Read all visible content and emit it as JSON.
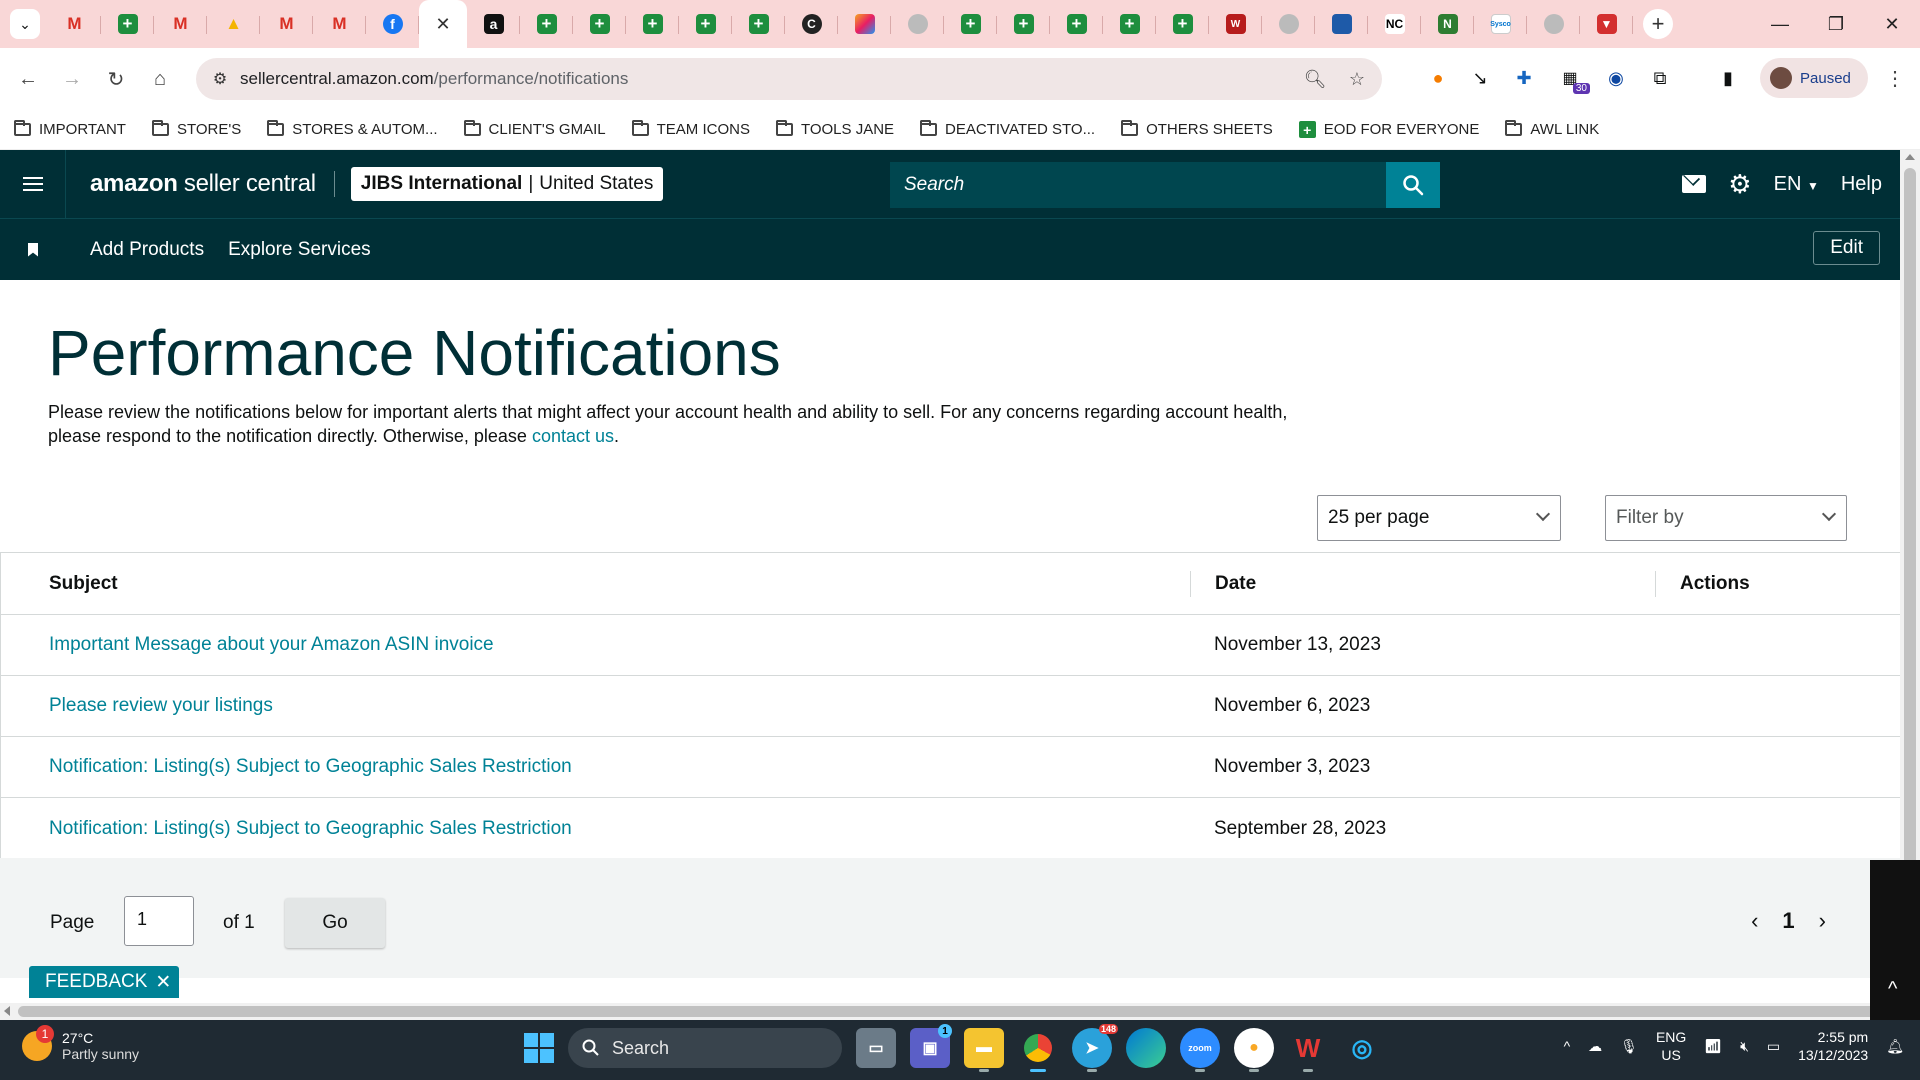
{
  "browser": {
    "tabs": [
      {
        "icon": "gmail-icon",
        "glyph": "M",
        "kind": "gmail"
      },
      {
        "icon": "sheets-icon",
        "glyph": "+",
        "kind": "sheet"
      },
      {
        "icon": "gmail-icon",
        "glyph": "M",
        "kind": "gmail"
      },
      {
        "icon": "drive-icon",
        "glyph": "▲",
        "kind": "drive"
      },
      {
        "icon": "gmail-icon",
        "glyph": "M",
        "kind": "gmail"
      },
      {
        "icon": "gmail-icon",
        "glyph": "M",
        "kind": "gmail"
      },
      {
        "icon": "facebook-icon",
        "glyph": "f",
        "kind": "fb"
      },
      {
        "icon": "close-icon",
        "glyph": "✕",
        "kind": "active"
      },
      {
        "icon": "amazon-icon",
        "glyph": "a",
        "kind": "amz"
      },
      {
        "icon": "sheets-icon",
        "glyph": "+",
        "kind": "sheet"
      },
      {
        "icon": "sheets-icon",
        "glyph": "+",
        "kind": "sheet"
      },
      {
        "icon": "sheets-icon",
        "glyph": "+",
        "kind": "sheet"
      },
      {
        "icon": "sheets-icon",
        "glyph": "+",
        "kind": "sheet"
      },
      {
        "icon": "sheets-icon",
        "glyph": "+",
        "kind": "sheet"
      },
      {
        "icon": "c-circle-icon",
        "glyph": "C",
        "kind": "circ"
      },
      {
        "icon": "multicolor-app-icon",
        "glyph": "",
        "kind": "colored"
      },
      {
        "icon": "grey-globe-icon",
        "glyph": "",
        "kind": "grey"
      },
      {
        "icon": "sheets-icon",
        "glyph": "+",
        "kind": "sheet"
      },
      {
        "icon": "sheets-icon",
        "glyph": "+",
        "kind": "sheet"
      },
      {
        "icon": "sheets-icon",
        "glyph": "+",
        "kind": "sheet"
      },
      {
        "icon": "sheets-icon",
        "glyph": "+",
        "kind": "sheet"
      },
      {
        "icon": "sheets-icon",
        "glyph": "+",
        "kind": "sheet"
      },
      {
        "icon": "ww-icon",
        "glyph": "W",
        "kind": "wwred"
      },
      {
        "icon": "grey-logo-icon",
        "glyph": "",
        "kind": "grey"
      },
      {
        "icon": "blue-swoosh-icon",
        "glyph": "",
        "kind": "blue"
      },
      {
        "icon": "nc-icon",
        "glyph": "NC",
        "kind": "nc"
      },
      {
        "icon": "green-n-icon",
        "glyph": "N",
        "kind": "green2"
      },
      {
        "icon": "sysco-icon",
        "glyph": "Sysco",
        "kind": "sysco"
      },
      {
        "icon": "badge-icon",
        "glyph": "",
        "kind": "grey"
      },
      {
        "icon": "red-v-icon",
        "glyph": "▼",
        "kind": "red2"
      }
    ],
    "url_host": "sellercentral.amazon.com",
    "url_path": "/performance/notifications",
    "profile_status": "Paused",
    "ext_badge": "30",
    "bookmarks": [
      {
        "label": "IMPORTANT",
        "type": "folder"
      },
      {
        "label": "STORE'S",
        "type": "folder"
      },
      {
        "label": "STORES & AUTOM...",
        "type": "folder"
      },
      {
        "label": "CLIENT'S GMAIL",
        "type": "folder"
      },
      {
        "label": "TEAM ICONS",
        "type": "folder"
      },
      {
        "label": "TOOLS JANE",
        "type": "folder"
      },
      {
        "label": "DEACTIVATED STO...",
        "type": "folder"
      },
      {
        "label": "OTHERS SHEETS",
        "type": "folder"
      },
      {
        "label": "EOD FOR EVERYONE",
        "type": "sheet"
      },
      {
        "label": "AWL LINK",
        "type": "folder"
      }
    ]
  },
  "header": {
    "logo_bold": "amazon",
    "logo_rest": " seller central",
    "store_name": "JIBS International",
    "store_sep": "|",
    "store_region": "United States",
    "search_placeholder": "Search",
    "lang": "EN",
    "help": "Help",
    "sub_links": [
      "Add Products",
      "Explore Services"
    ],
    "edit": "Edit"
  },
  "main": {
    "title": "Performance Notifications",
    "desc_before": "Please review the notifications below for important alerts that might affect your account health and ability to sell. For any concerns regarding account health, please respond to the notification directly. Otherwise, please ",
    "desc_link": "contact us",
    "desc_after": ".",
    "per_page": "25 per page",
    "filter_placeholder": "Filter by",
    "columns": [
      "Subject",
      "Date",
      "Actions"
    ],
    "rows": [
      {
        "subject": "Important Message about your Amazon ASIN invoice",
        "date": "November 13, 2023",
        "action": ""
      },
      {
        "subject": "Please review your listings",
        "date": "November 6, 2023",
        "action": ""
      },
      {
        "subject": "Notification: Listing(s) Subject to Geographic Sales Restriction",
        "date": "November 3, 2023",
        "action": ""
      },
      {
        "subject": "Notification: Listing(s) Subject to Geographic Sales Restriction",
        "date": "September 28, 2023",
        "action": ""
      }
    ],
    "pager": {
      "page_label": "Page",
      "page_value": "1",
      "of_label": "of 1",
      "go": "Go",
      "current": "1"
    },
    "feedback": "FEEDBACK"
  },
  "taskbar": {
    "weather_temp": "27°C",
    "weather_desc": "Partly sunny",
    "weather_badge": "1",
    "search": "Search",
    "teams_badge": "1",
    "telegram_badge": "148",
    "lang_top": "ENG",
    "lang_bottom": "US",
    "time": "2:55 pm",
    "date": "13/12/2023"
  }
}
